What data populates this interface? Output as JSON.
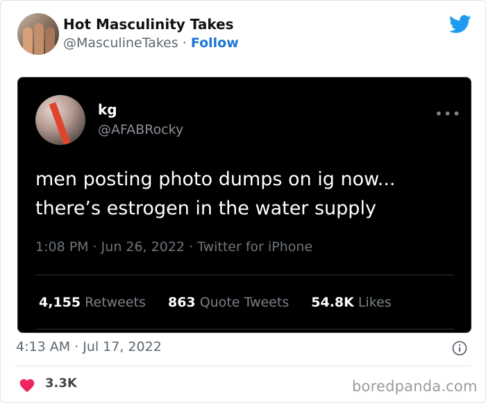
{
  "outer_tweet": {
    "author_name": "Hot Masculinity Takes",
    "handle": "@MasculineTakes",
    "separator": "·",
    "follow_label": "Follow",
    "timestamp": "4:13 AM · Jul 17, 2022",
    "likes": "3.3K",
    "colors": {
      "follow": "#1d74d4",
      "like_heart": "#f0245e",
      "twitter_bird": "#1d9bf0"
    },
    "icons": [
      "twitter-bird-icon",
      "info-icon",
      "heart-icon"
    ]
  },
  "embedded_tweet": {
    "name": "kg",
    "handle": "@AFABRocky",
    "more_icon": "•••",
    "text_line1": "men posting photo dumps on ig now...",
    "text_line2": "there’s estrogen in the water supply",
    "meta": "1:08 PM · Jun 26, 2022 · Twitter for iPhone",
    "stats": {
      "retweets_count": "4,155",
      "retweets_label": "Retweets",
      "quotes_count": "863",
      "quotes_label": "Quote Tweets",
      "likes_count": "54.8K",
      "likes_label": "Likes"
    }
  },
  "watermark": "boredpanda.com"
}
